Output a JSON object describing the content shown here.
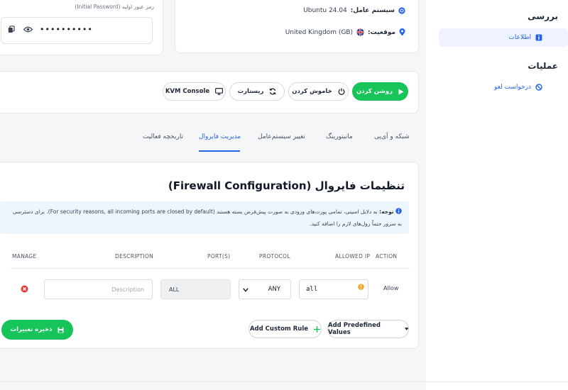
{
  "sidebar": {
    "section_review": "بررسی",
    "item_info": "اطلاعات",
    "section_operations": "عملیات",
    "item_cancel": "درخواست لغو"
  },
  "credentials": {
    "password_label": "رمز عبور اولیه (Initial Password)",
    "password_mask": "••••••••••"
  },
  "server_info": {
    "os_label": "سیستم عامل:",
    "os_value": "Ubuntu 24.04",
    "location_label": "موقعیت:",
    "location_value": "United Kingdom (GB)"
  },
  "actions": {
    "power_on": "روشن کردن",
    "power_off": "خاموش کردن",
    "restart": "ریستارت",
    "kvm": "KVM Console"
  },
  "tabs": [
    {
      "label": "شبکه و آی‌پی"
    },
    {
      "label": "مانیتورینگ"
    },
    {
      "label": "تغییر سیستم‌عامل"
    },
    {
      "label": "مدیریت فایروال"
    },
    {
      "label": "تاریخچه فعالیت"
    }
  ],
  "firewall": {
    "title": "تنظیمات فایروال (Firewall Configuration)",
    "notice_bold": "توجه:",
    "notice_text": " به دلایل امنیتی، تمامی پورت‌های ورودی به صورت پیش‌فرض بسته هستند (For security reasons, all incoming ports are closed by default). برای دسترسی به سرور حتماً رول‌های لازم را اضافه کنید.",
    "columns": {
      "action": "ACTION",
      "allowed_ip": "ALLOWED IP",
      "protocol": "PROTOCOL",
      "ports": "PORT(S)",
      "description": "DESCRIPTION",
      "manage": "MANAGE"
    },
    "row": {
      "action": "Allow",
      "allowed_ip": "all",
      "protocol": "ANY",
      "ports": "ALL",
      "description_placeholder": "Description"
    },
    "add_predefined": "Add Predefined Values",
    "add_custom": "Add Custom Rule",
    "save": "ذخیره تغییرات"
  },
  "colors": {
    "accent_blue": "#2563eb",
    "success_green": "#16c45a",
    "danger_red": "#e53935",
    "warning_amber": "#f5a623"
  }
}
